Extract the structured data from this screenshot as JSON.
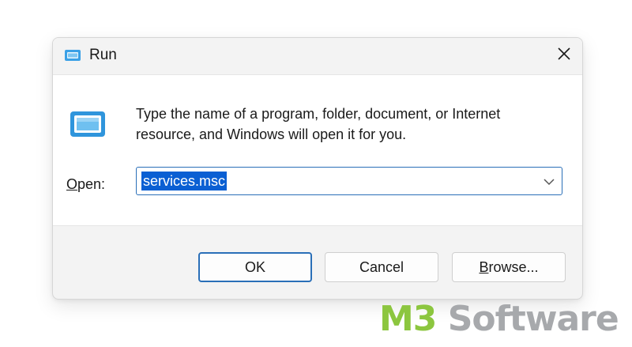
{
  "window": {
    "title": "Run",
    "close_icon": "close-icon",
    "icon": "run-app-icon"
  },
  "content": {
    "description_line1": "Type the name of a program, folder, document, or Internet",
    "description_line2": "resource, and Windows will open it for you.",
    "open_label_accel": "O",
    "open_label_rest": "pen:",
    "input_value": "services.msc",
    "selection_color": "#0a5fd3"
  },
  "buttons": {
    "ok": "OK",
    "cancel": "Cancel",
    "browse_accel": "B",
    "browse_rest": "rowse..."
  },
  "watermark": {
    "part1": "M3",
    "part2": " Software",
    "color1": "#8cc63f",
    "color2": "#a7a9ac"
  },
  "colors": {
    "accent": "#2a6fb8",
    "dialog_bg": "#f3f3f3",
    "content_bg": "#ffffff"
  }
}
